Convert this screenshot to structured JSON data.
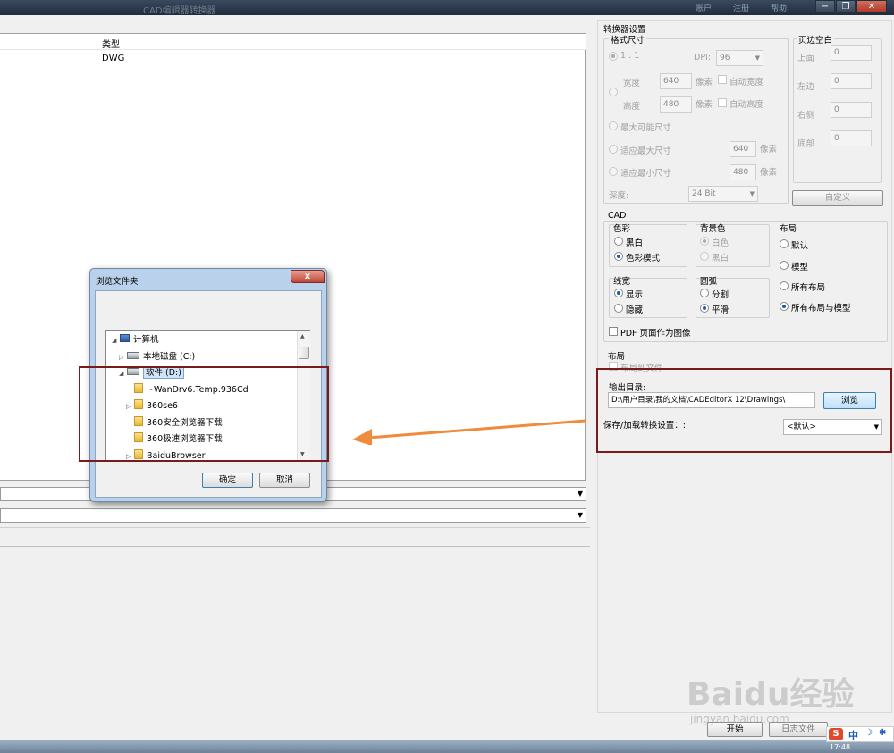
{
  "window": {
    "title": "CAD编辑器转换器"
  },
  "titlebar_right": [
    "账户",
    "注册",
    "帮助"
  ],
  "filelist": {
    "col_type": "类型",
    "rows": [
      {
        "type": "DWG"
      }
    ]
  },
  "converter": {
    "title": "转换器设置",
    "format_size": {
      "title": "格式尺寸",
      "ratio_label": "1 : 1",
      "dpi_label": "DPI:",
      "dpi_value": "96",
      "width_label": "宽度",
      "width_value": "640",
      "height_label": "高度",
      "height_value": "480",
      "pixel_label": "像素",
      "auto_width": "自动宽度",
      "auto_height": "自动高度",
      "max_possible": "最大可能尺寸",
      "fit_max": "适应最大尺寸",
      "fit_max_value": "640",
      "fit_min": "适应最小尺寸",
      "fit_min_value": "480",
      "depth_label": "深度:",
      "depth_value": "24 Bit"
    },
    "margins": {
      "title": "页边空白",
      "top_label": "上面",
      "top_value": "0",
      "left_label": "左边",
      "left_value": "0",
      "right_label": "右侧",
      "right_value": "0",
      "bottom_label": "底部",
      "bottom_value": "0",
      "custom_button": "自定义"
    },
    "cad": {
      "title": "CAD",
      "color": {
        "title": "色彩",
        "bw": "黑白",
        "color_mode": "色彩模式"
      },
      "background": {
        "title": "背景色",
        "white": "白色",
        "black": "黑白"
      },
      "layout": {
        "title": "布局",
        "default": "默认",
        "model": "模型",
        "all_layouts": "所有布局",
        "all_layouts_model": "所有布局与模型"
      },
      "linewidth": {
        "title": "线宽",
        "show": "显示",
        "hide": "隐藏"
      },
      "arc": {
        "title": "圆弧",
        "split": "分割",
        "smooth": "平滑"
      },
      "pdf_as_image": "PDF 页面作为图像"
    },
    "layout_section": {
      "title": "布局",
      "layout_to_file": "布局到文件",
      "output_dir_label": "输出目录:",
      "output_dir_value": "D:\\用户目录\\我的文档\\CADEditorX 12\\Drawings\\",
      "browse_button": "浏览",
      "save_load_label": "保存/加载转换设置：:",
      "save_load_value": "<默认>"
    },
    "start_button": "开始",
    "log_button": "日志文件"
  },
  "dialog": {
    "title": "浏览文件夹",
    "close_symbol": "x",
    "tree": [
      {
        "label": "计算机",
        "level": 0,
        "kind": "computer",
        "expander": "◢"
      },
      {
        "label": "本地磁盘 (C:)",
        "level": 1,
        "kind": "drive",
        "expander": "▷"
      },
      {
        "label": "软件 (D:)",
        "level": 1,
        "kind": "drive",
        "expander": "◢",
        "selected": true
      },
      {
        "label": "~WanDrv6.Temp.936Cd",
        "level": 2,
        "kind": "folder",
        "expander": ""
      },
      {
        "label": "360se6",
        "level": 2,
        "kind": "folder",
        "expander": "▷"
      },
      {
        "label": "360安全浏览器下载",
        "level": 2,
        "kind": "folder",
        "expander": ""
      },
      {
        "label": "360极速浏览器下载",
        "level": 2,
        "kind": "folder",
        "expander": ""
      },
      {
        "label": "BaiduBrowser",
        "level": 2,
        "kind": "folder",
        "expander": "▷"
      }
    ],
    "ok_button": "确定",
    "cancel_button": "取消"
  },
  "watermark": {
    "brand": "Baidu经验",
    "url": "jingyan.baidu.com"
  },
  "tray": {
    "ime": "中",
    "time": "17:48"
  },
  "colors": {
    "accent": "#1a5bb8",
    "highlight_frame": "#7a1a1a",
    "arrow": "#f08a3c"
  }
}
